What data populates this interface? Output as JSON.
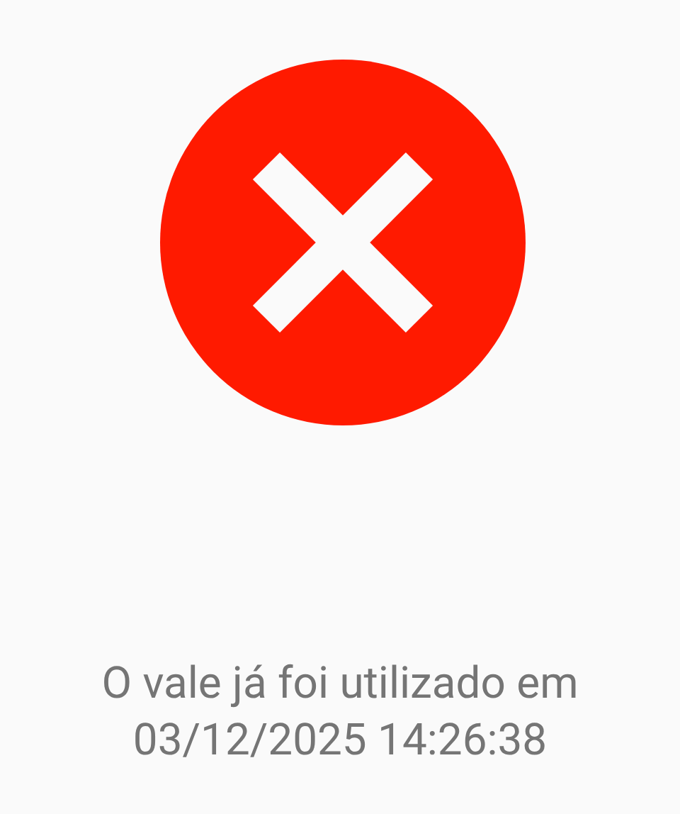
{
  "status": {
    "kind": "error"
  },
  "message": "O vale já foi utilizado em 03/12/2025 14:26:38"
}
